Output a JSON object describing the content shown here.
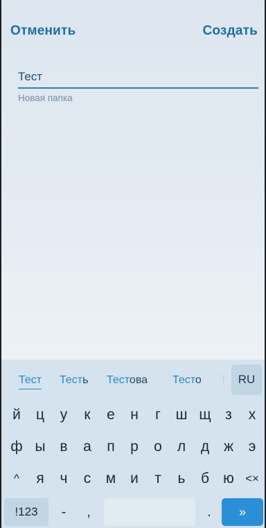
{
  "header": {
    "cancel_label": "Отменить",
    "create_label": "Создать"
  },
  "form": {
    "folder_name_value": "Тест",
    "hint_text": "Новая папка"
  },
  "keyboard": {
    "suggestions": [
      {
        "typed": "Тест",
        "rest": ""
      },
      {
        "typed": "Тест",
        "rest": "ь"
      },
      {
        "typed": "Тест",
        "rest": "ова"
      },
      {
        "typed": "Тест",
        "rest": "о"
      }
    ],
    "faded_suggestion": "Т",
    "language_key": "RU",
    "row1": [
      "й",
      "ц",
      "у",
      "к",
      "е",
      "н",
      "г",
      "ш",
      "щ",
      "з",
      "х"
    ],
    "row2": [
      "ф",
      "ы",
      "в",
      "а",
      "п",
      "р",
      "о",
      "л",
      "д",
      "ж",
      "э"
    ],
    "row3": [
      "я",
      "ч",
      "с",
      "м",
      "и",
      "т",
      "ь",
      "б",
      "ю"
    ],
    "shift_key": "^",
    "backspace_key": "<×",
    "numbers_key": "!123",
    "minus_key": "-",
    "comma_key": ",",
    "dot_key": ".",
    "enter_key": "»"
  }
}
